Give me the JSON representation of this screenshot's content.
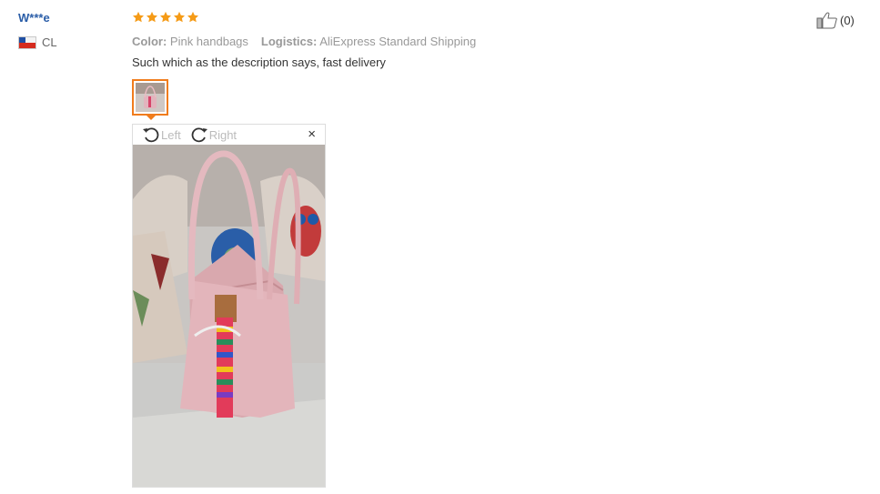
{
  "reviewer": {
    "name": "W***e",
    "country_code": "CL"
  },
  "review": {
    "rating": 5,
    "color_label": "Color:",
    "color_value": "Pink handbags",
    "logistics_label": "Logistics:",
    "logistics_value": "AliExpress Standard Shipping",
    "text": "Such which as the description says, fast delivery"
  },
  "viewer": {
    "rotate_left_label": "Left",
    "rotate_right_label": "Right",
    "close_symbol": "×"
  },
  "helpful": {
    "count_text": "(0)"
  },
  "colors": {
    "star": "#f59b17",
    "accent": "#f07c1d",
    "link": "#2b5ea8"
  }
}
